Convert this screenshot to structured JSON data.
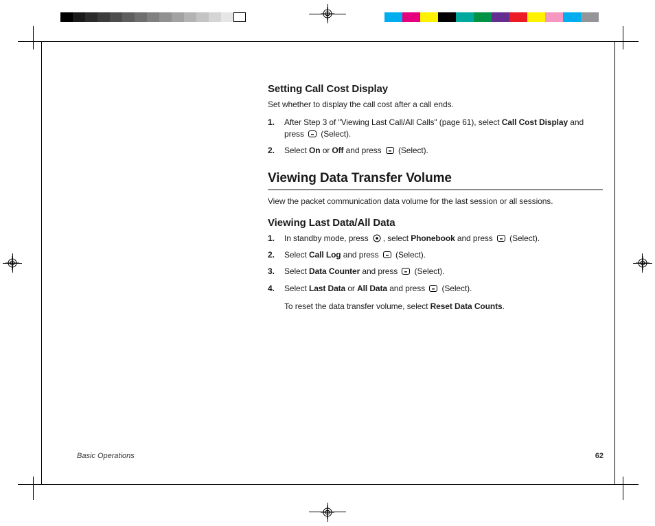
{
  "footer": {
    "section": "Basic Operations",
    "page": "62"
  },
  "colorbars": {
    "left": [
      "#000000",
      "#1a1a1a",
      "#2b2b2b",
      "#3c3c3c",
      "#4d4d4d",
      "#5e5e5e",
      "#6f6f6f",
      "#808080",
      "#919191",
      "#a2a2a2",
      "#b3b3b3",
      "#c4c4c4",
      "#d5d5d5",
      "#e6e6e6",
      "#ffffff"
    ],
    "right": [
      "#00adee",
      "#e6007e",
      "#fff200",
      "#000000",
      "#00a99d",
      "#009245",
      "#662d91",
      "#ed1c24",
      "#fff200",
      "#f497c1",
      "#00adee",
      "#939598"
    ]
  },
  "s1": {
    "heading": "Setting Call Cost Display",
    "desc": "Set whether to display the call cost after a call ends.",
    "steps": [
      {
        "pre": "After Step 3 of \"Viewing Last Call/All Calls\" (page 61), select ",
        "bold1": "Call Cost Display",
        "mid1": " and press ",
        "key1": "softkey",
        "post": " (Select)."
      },
      {
        "pre": "Select ",
        "bold1": "On",
        "mid1": " or ",
        "bold2": "Off",
        "mid2": " and press ",
        "key1": "softkey",
        "post": " (Select)."
      }
    ]
  },
  "s2": {
    "heading": "Viewing Data Transfer Volume",
    "desc": "View the packet communication data volume for the last session or all sessions."
  },
  "s3": {
    "heading": "Viewing Last Data/All Data",
    "steps": [
      {
        "pre": "In standby mode, press ",
        "key1": "center",
        "mid1": ", select ",
        "bold1": "Phonebook",
        "mid2": " and press ",
        "key2": "softkey",
        "post": " (Select)."
      },
      {
        "pre": "Select ",
        "bold1": "Call Log",
        "mid1": " and press ",
        "key1": "softkey",
        "post": " (Select)."
      },
      {
        "pre": "Select ",
        "bold1": "Data Counter",
        "mid1": " and press ",
        "key1": "softkey",
        "post": " (Select)."
      },
      {
        "pre": "Select ",
        "bold1": "Last Data",
        "mid1": " or ",
        "bold2": "All Data",
        "mid2": " and press ",
        "key1": "softkey",
        "post": " (Select)."
      }
    ],
    "note_pre": "To reset the data transfer volume, select ",
    "note_bold": "Reset Data Counts",
    "note_post": "."
  }
}
